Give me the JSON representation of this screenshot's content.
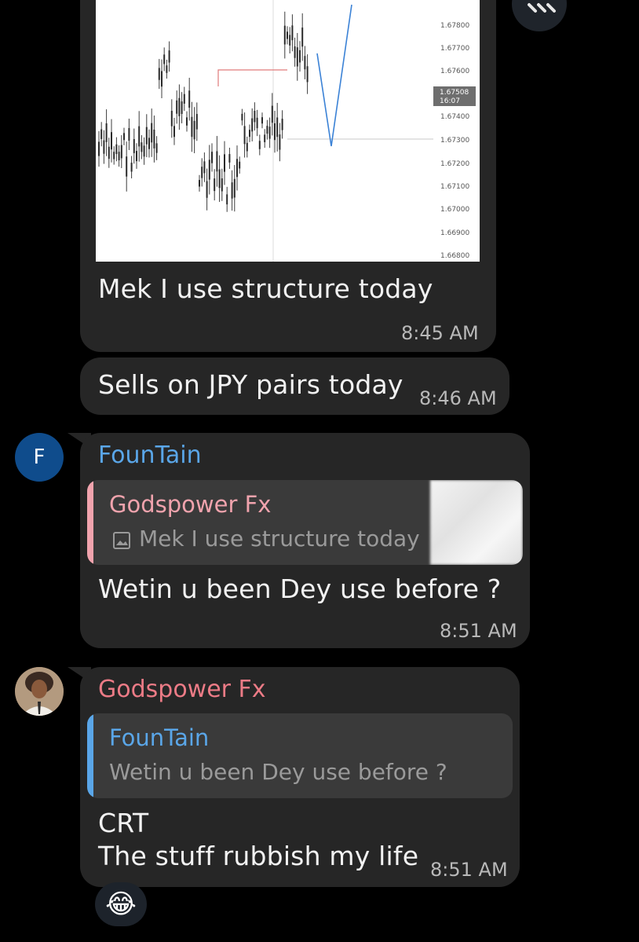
{
  "messages": [
    {
      "type": "image",
      "caption": "Mek I use structure today",
      "time": "8:45 AM",
      "chart_labels": [
        "1.67800",
        "1.67700",
        "1.67600",
        "1.67400",
        "1.67300",
        "1.67200",
        "1.67100",
        "1.67000",
        "1.66900",
        "1.66800"
      ],
      "current_price": "1.67508",
      "current_time": "16:07"
    },
    {
      "type": "text",
      "text": "Sells on JPY pairs today",
      "time": "8:46 AM"
    },
    {
      "type": "reply",
      "avatar_letter": "F",
      "sender": "FounTain",
      "quoted_sender": "Godspower Fx",
      "quoted_text": "Mek I use structure today",
      "text": "Wetin u been Dey use before ?",
      "time": "8:51 AM"
    },
    {
      "type": "reply",
      "sender": "Godspower Fx",
      "quoted_sender": "FounTain",
      "quoted_text": "Wetin u been Dey use before ?",
      "text_line1": "CRT",
      "text_line2": "The stuff rubbish my life",
      "time": "8:51 AM",
      "reaction": "😂"
    }
  ],
  "colors": {
    "fountain": "#5aa6e8",
    "godspower_quote": "#f0a3ad",
    "godspower_sender": "#ec7b86",
    "bubble": "#262626",
    "avatar_f": "#0f4c8c"
  },
  "icons": {
    "image_icon": "image-icon",
    "scroll_button": "chevron-icon"
  }
}
